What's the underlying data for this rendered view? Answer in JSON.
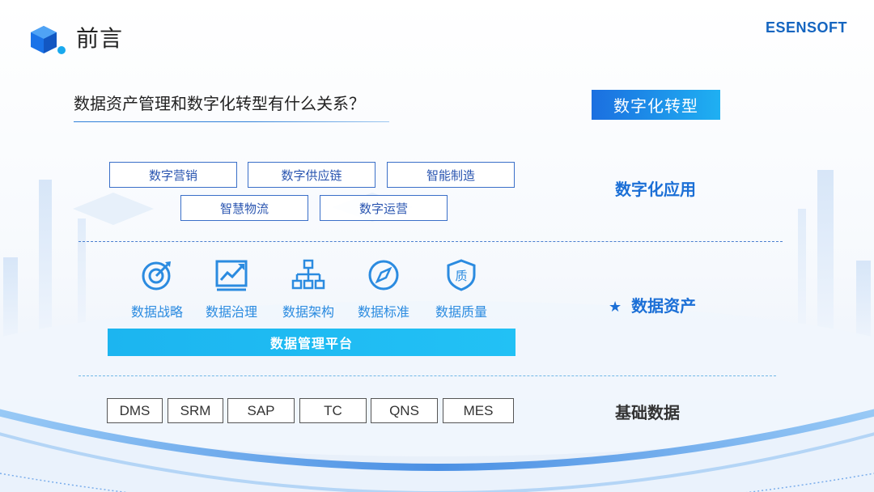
{
  "header": {
    "title": "前言",
    "brand": "ESENSOFT"
  },
  "question": "数据资产管理和数字化转型有什么关系？",
  "transformation_badge": "数字化转型",
  "applications": {
    "label": "数字化应用",
    "items": [
      "数字营销",
      "数字供应链",
      "智能制造",
      "智慧物流",
      "数字运营"
    ]
  },
  "data_assets": {
    "star": "★",
    "label": "数据资产",
    "items": [
      {
        "label": "数据战略",
        "icon": "target-icon"
      },
      {
        "label": "数据治理",
        "icon": "trend-chart-icon"
      },
      {
        "label": "数据架构",
        "icon": "hierarchy-icon"
      },
      {
        "label": "数据标准",
        "icon": "compass-icon"
      },
      {
        "label": "数据质量",
        "icon": "quality-shield-icon"
      }
    ],
    "platform": "数据管理平台"
  },
  "base_data": {
    "label": "基础数据",
    "items": [
      "DMS",
      "SRM",
      "SAP",
      "TC",
      "QNS",
      "MES"
    ]
  },
  "colors": {
    "primary_blue": "#1b6fd6",
    "accent_cyan": "#1cb5f0",
    "brand_blue": "#1565c0"
  }
}
